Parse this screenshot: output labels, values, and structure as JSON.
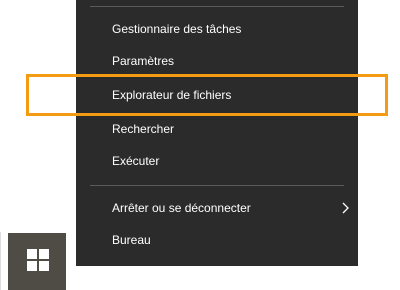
{
  "menu": {
    "items": [
      {
        "label": "Gestionnaire des tâches"
      },
      {
        "label": "Paramètres"
      },
      {
        "label": "Explorateur de fichiers"
      },
      {
        "label": "Rechercher"
      },
      {
        "label": "Exécuter"
      },
      {
        "label": "Arrêter ou se déconnecter",
        "has_submenu": true
      },
      {
        "label": "Bureau"
      }
    ]
  },
  "highlight": {
    "color": "#f39c12",
    "target": "Explorateur de fichiers"
  },
  "start_button": {
    "icon": "windows-logo-icon",
    "background": "#4f4b45"
  }
}
